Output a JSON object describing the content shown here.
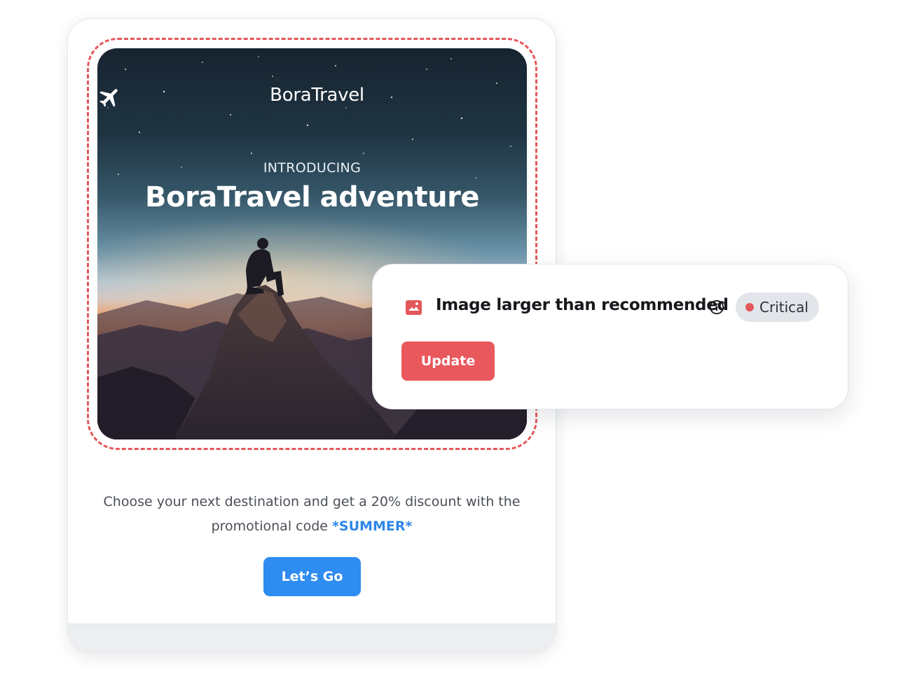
{
  "email": {
    "brand_name": "BoraTravel",
    "hero_eyebrow": "INTRODUCING",
    "hero_title": "BoraTravel adventure",
    "promo_text": "Choose your next destination and get a 20% discount with the promotional code",
    "promo_code": "*SUMMER*",
    "cta_label": "Let’s Go"
  },
  "alert": {
    "icon": "image-warning-icon",
    "title": "Image larger than recommended",
    "severity_label": "Critical",
    "severity_color": "#e4575a",
    "update_label": "Update"
  },
  "colors": {
    "accent_blue": "#2f8cf0",
    "accent_red": "#e8585c",
    "outline_red": "#e4575a"
  }
}
